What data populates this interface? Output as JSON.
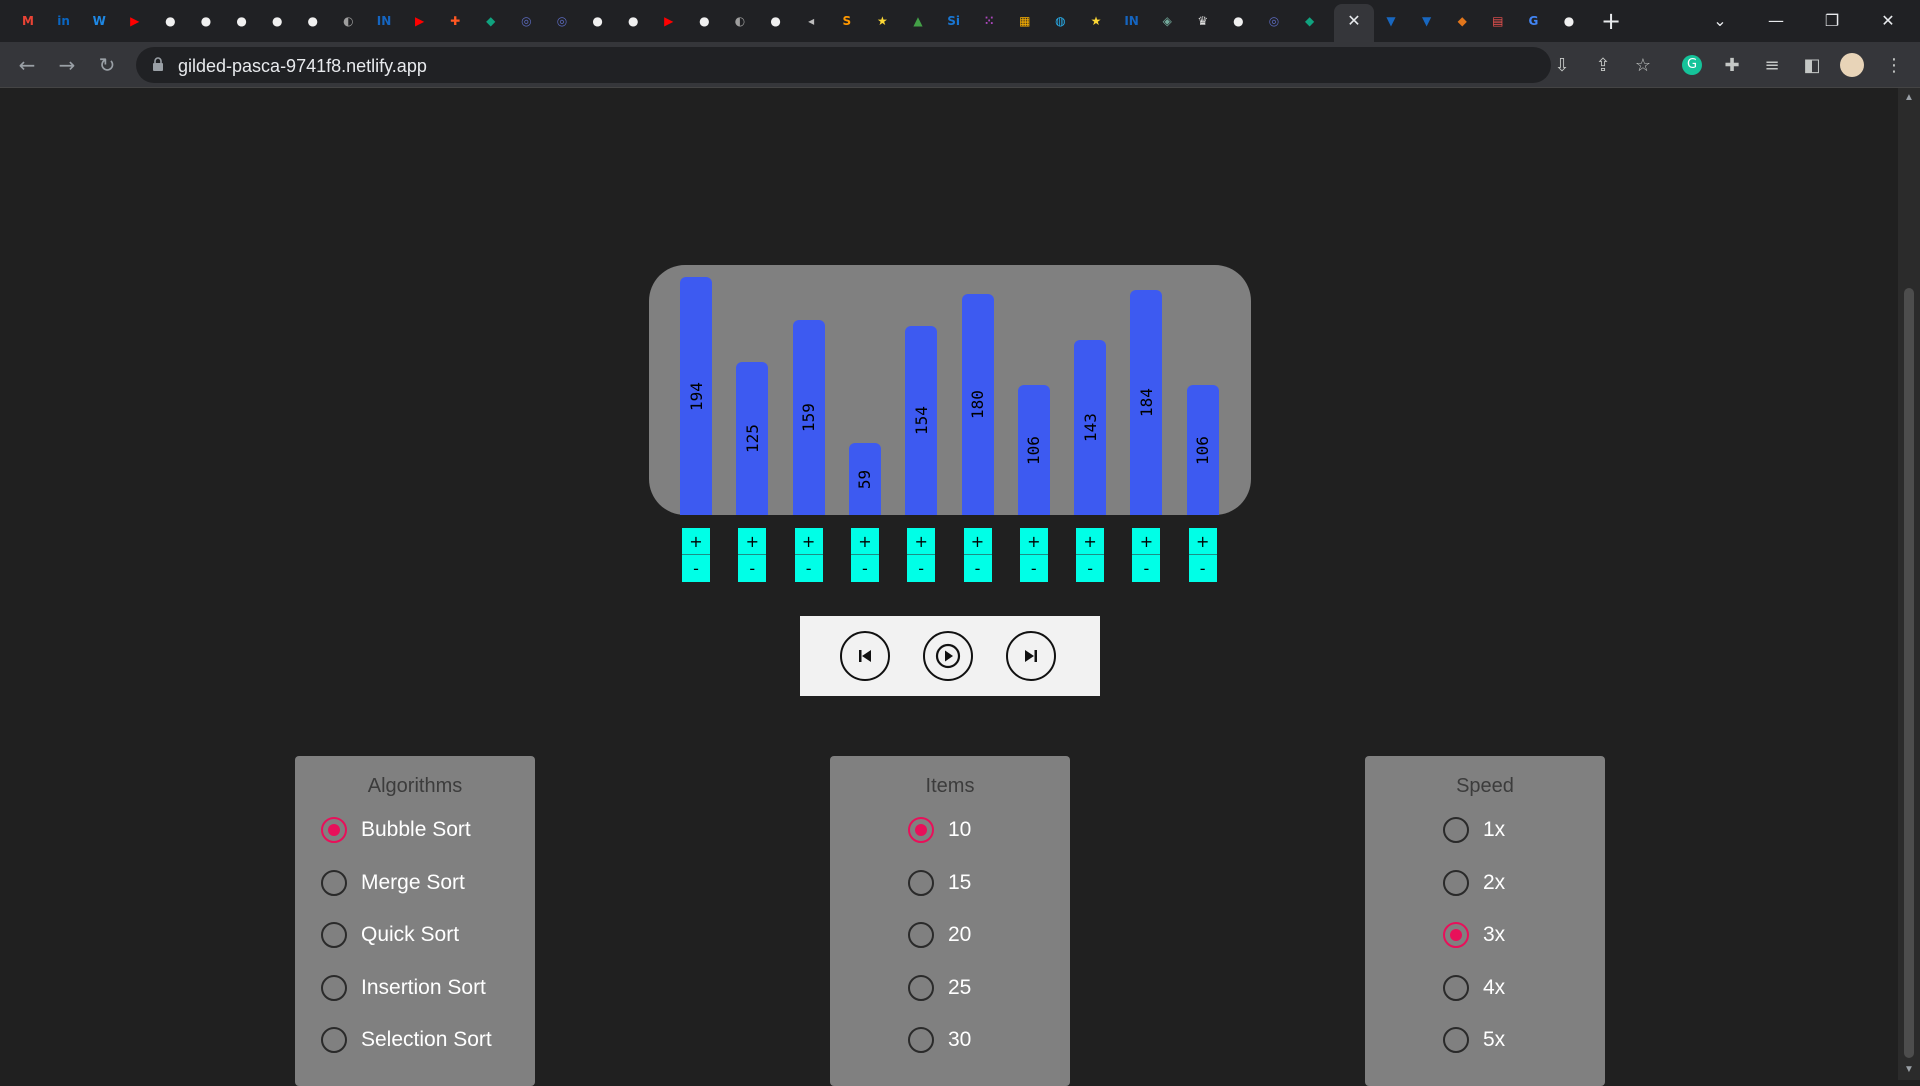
{
  "browser": {
    "tabs": [
      {
        "icon": "gmail-icon",
        "glyph": "M",
        "color": "#ea4335"
      },
      {
        "icon": "linkedin-icon",
        "glyph": "in",
        "color": "#0a66c2"
      },
      {
        "icon": "w-icon",
        "glyph": "W",
        "color": "#1e88e5"
      },
      {
        "icon": "youtube-icon",
        "glyph": "▶",
        "color": "#ff0000"
      },
      {
        "icon": "github-icon",
        "glyph": "●",
        "color": "#f0f0f0"
      },
      {
        "icon": "github-icon",
        "glyph": "●",
        "color": "#f0f0f0"
      },
      {
        "icon": "github-icon",
        "glyph": "●",
        "color": "#f0f0f0"
      },
      {
        "icon": "github-icon",
        "glyph": "●",
        "color": "#f0f0f0"
      },
      {
        "icon": "github-icon",
        "glyph": "●",
        "color": "#f0f0f0"
      },
      {
        "icon": "globe-icon",
        "glyph": "◐",
        "color": "#9e9e9e"
      },
      {
        "icon": "in-icon",
        "glyph": "IN",
        "color": "#1565c0"
      },
      {
        "icon": "youtube-icon",
        "glyph": "▶",
        "color": "#ff0000"
      },
      {
        "icon": "puzzle-icon",
        "glyph": "✚",
        "color": "#ff5722"
      },
      {
        "icon": "diamond-icon",
        "glyph": "◆",
        "color": "#10a37f"
      },
      {
        "icon": "swirl-icon",
        "glyph": "◎",
        "color": "#5c6bc0"
      },
      {
        "icon": "swirl-icon",
        "glyph": "◎",
        "color": "#5c6bc0"
      },
      {
        "icon": "github-icon",
        "glyph": "●",
        "color": "#f0f0f0"
      },
      {
        "icon": "github-icon",
        "glyph": "●",
        "color": "#f0f0f0"
      },
      {
        "icon": "youtube-icon",
        "glyph": "▶",
        "color": "#ff0000"
      },
      {
        "icon": "github-icon",
        "glyph": "●",
        "color": "#f0f0f0"
      },
      {
        "icon": "globe-icon",
        "glyph": "◐",
        "color": "#9e9e9e"
      },
      {
        "icon": "github-icon",
        "glyph": "●",
        "color": "#f0f0f0"
      },
      {
        "icon": "speaker-icon",
        "glyph": "◂",
        "color": "#bdbdbd"
      },
      {
        "icon": "s-icon",
        "glyph": "S",
        "color": "#ff9800"
      },
      {
        "icon": "star-icon",
        "glyph": "★",
        "color": "#fdd835"
      },
      {
        "icon": "tree-icon",
        "glyph": "▲",
        "color": "#43a047"
      },
      {
        "icon": "si-icon",
        "glyph": "Si",
        "color": "#1976d2"
      },
      {
        "icon": "dice-icon",
        "glyph": "⁙",
        "color": "#ab47bc"
      },
      {
        "icon": "grid-icon",
        "glyph": "▦",
        "color": "#ffb300"
      },
      {
        "icon": "earth-icon",
        "glyph": "◍",
        "color": "#29b6f6"
      },
      {
        "icon": "star-icon",
        "glyph": "★",
        "color": "#fdd835"
      },
      {
        "icon": "in-icon",
        "glyph": "IN",
        "color": "#1565c0"
      },
      {
        "icon": "chatgpt-icon",
        "glyph": "◈",
        "color": "#74aa9c"
      },
      {
        "icon": "crown-icon",
        "glyph": "♛",
        "color": "#e0e0e0"
      },
      {
        "icon": "github-icon",
        "glyph": "●",
        "color": "#f0f0f0"
      },
      {
        "icon": "swirl-icon",
        "glyph": "◎",
        "color": "#5c6bc0"
      },
      {
        "icon": "diamond-icon",
        "glyph": "◆",
        "color": "#10a37f"
      }
    ],
    "tabs_after": [
      {
        "icon": "vuetify-icon",
        "glyph": "▼",
        "color": "#1867c0"
      },
      {
        "icon": "vuetify-icon",
        "glyph": "▼",
        "color": "#1867c0"
      },
      {
        "icon": "metamask-icon",
        "glyph": "◆",
        "color": "#e2761b"
      },
      {
        "icon": "store-icon",
        "glyph": "▤",
        "color": "#ef5350"
      },
      {
        "icon": "google-icon",
        "glyph": "G",
        "color": "#4285f4"
      },
      {
        "icon": "github-icon",
        "glyph": "●",
        "color": "#f0f0f0"
      }
    ],
    "url": "gilded-pasca-9741f8.netlify.app"
  },
  "chart_data": {
    "type": "bar",
    "values": [
      194,
      125,
      159,
      59,
      154,
      180,
      106,
      143,
      184,
      106
    ]
  },
  "stepper": {
    "plus": "+",
    "minus": "-"
  },
  "algorithms": {
    "title": "Algorithms",
    "options": [
      "Bubble Sort",
      "Merge Sort",
      "Quick Sort",
      "Insertion Sort",
      "Selection Sort"
    ],
    "selected": "Bubble Sort"
  },
  "items": {
    "title": "Items",
    "options": [
      "10",
      "15",
      "20",
      "25",
      "30"
    ],
    "selected": "10"
  },
  "speed": {
    "title": "Speed",
    "options": [
      "1x",
      "2x",
      "3x",
      "4x",
      "5x"
    ],
    "selected": "3x"
  },
  "colors": {
    "bar": "#3d5af1",
    "stepper": "#00ffe7",
    "radio_selected": "#e8105a",
    "panel": "#808080",
    "background": "#202020"
  }
}
